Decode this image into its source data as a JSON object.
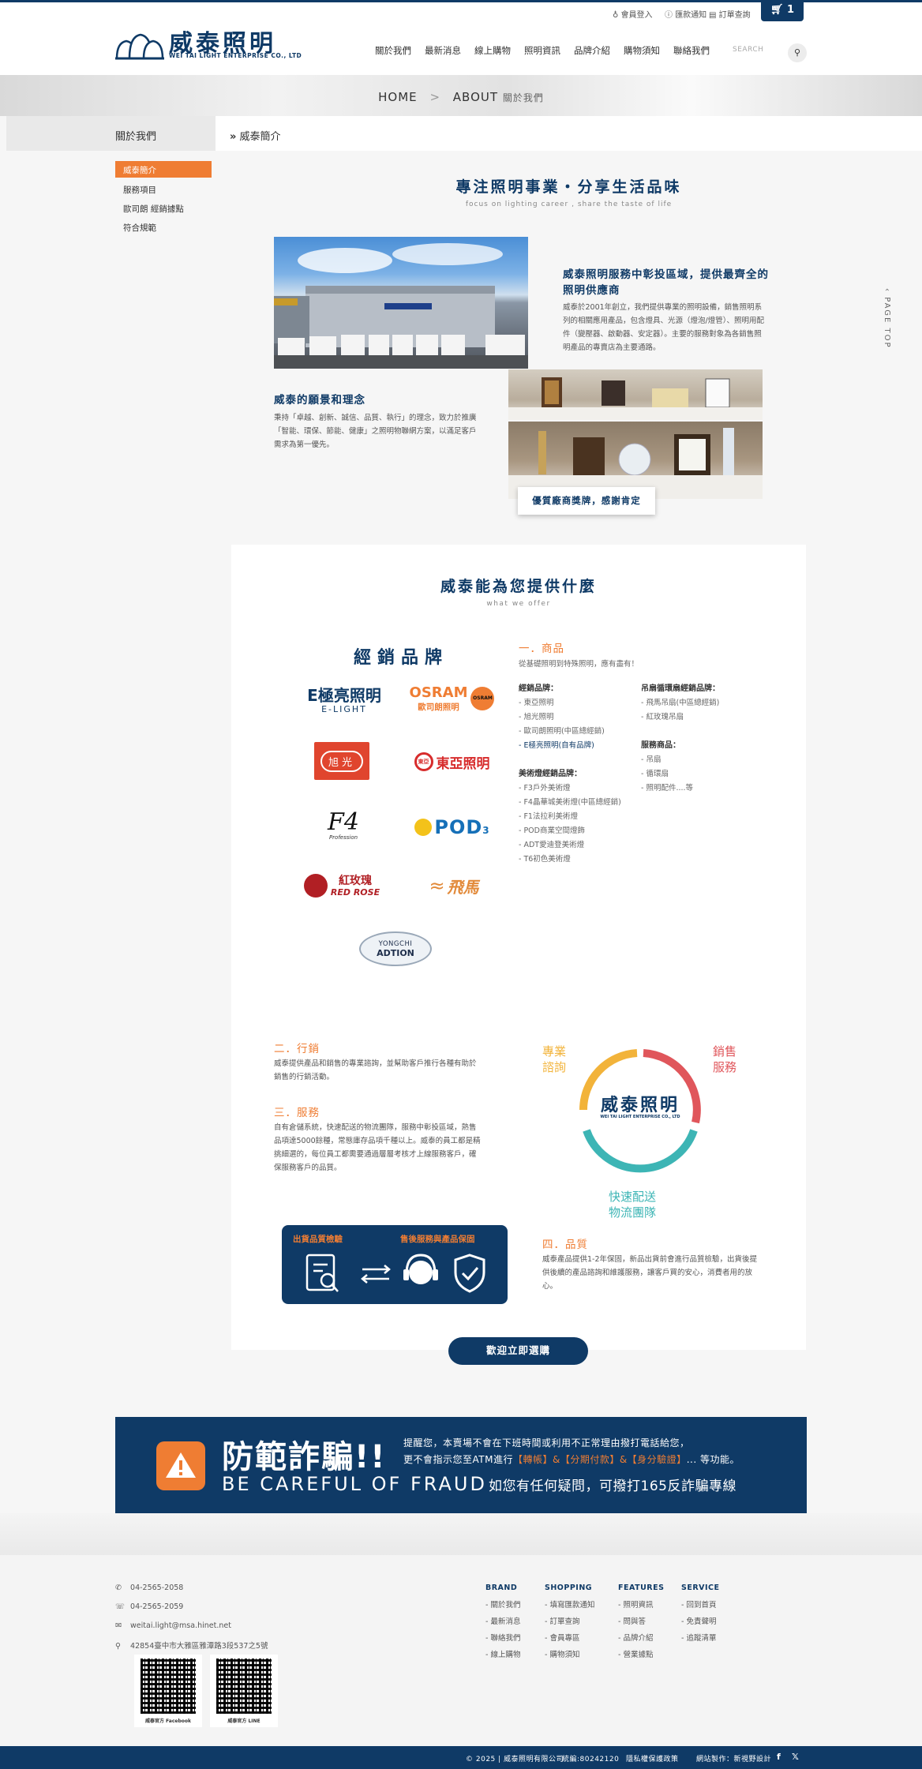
{
  "header": {
    "logo_cn": "威泰照明",
    "logo_en": "WEI TAI LIGHT ENTERPRISE CO., LTD",
    "util_links": [
      "會員登入",
      "匯款通知",
      "訂單查詢"
    ],
    "cart_count": "1",
    "nav": [
      "關於我們",
      "最新消息",
      "線上購物",
      "照明資訊",
      "品牌介紹",
      "購物須知",
      "聯絡我們"
    ],
    "search_placeholder": "SEARCH"
  },
  "breadcrumb": {
    "home": "HOME",
    "sep": ">",
    "about": "ABOUT",
    "sub": "關於我們"
  },
  "sidebar": {
    "title": "關於我們",
    "items": [
      "威泰簡介",
      "服務項目",
      "歐司朗 經銷據點",
      "符合規範"
    ],
    "active_index": 0
  },
  "section_title": "威泰簡介",
  "intro": {
    "title": "專注照明事業・分享生活品味",
    "subtitle": "focus on lighting career , share the taste of life",
    "block1_title": "威泰照明服務中彰投區域，提供最齊全的照明供應商",
    "block1_text": "威泰於2001年創立，我們提供專業的照明設備，銷售照明系列的相關應用產品，包含燈具、光源（燈泡/燈管）、照明用配件（變壓器、啟動器、安定器）。主要的服務對象為各銷售照明產品的專賣店為主要通路。",
    "block2_title": "威泰的願景和理念",
    "block2_text": "秉持「卓越、創新、誠信、品質、執行」的理念，致力於推廣「智能、環保、節能、健康」之照明物聯網方案，以滿足客戶需求為第一優先。",
    "award_label": "優質廠商獎牌，感謝肯定"
  },
  "page_top": "PAGE TOP",
  "offer": {
    "title": "威泰能為您提供什麼",
    "subtitle": "what we offer",
    "brands_title": "經銷品牌",
    "brand_logos": {
      "elight_cn": "E極亮照明",
      "elight_en": "E-LIGHT",
      "osram": "OSRAM",
      "osram_cn": "歐司朗照明",
      "osram_badge": "OSRAM",
      "xuguang": "旭光",
      "dongya": "東亞照明",
      "dongya_badge": "東亞",
      "f4": "F4",
      "f4_sub": "Profession",
      "pod": "POD",
      "pod_sub": "3",
      "redrose_cn": "紅玫瑰",
      "redrose_en": "RED ROSE",
      "feima": "飛馬",
      "yongchi": "YONGCHI",
      "yongchi_sub": "ADTION"
    },
    "products": {
      "heading": "一．商品",
      "desc": "從基礎照明到特殊照明，應有盡有！",
      "col1": [
        {
          "title": "經銷品牌：",
          "items": [
            "- 東亞照明",
            "- 旭光照明",
            "- 歐司朗照明(中區總經銷)",
            "- E極亮照明(自有品牌)"
          ]
        },
        {
          "title": "美術燈經銷品牌：",
          "items": [
            "- F3戶外美術燈",
            "- F4晶華城美術燈(中區總經銷)",
            "- F1法拉利美術燈",
            "- POD商業空間燈飾",
            "- ADT愛迪登美術燈",
            "- T6初色美術燈"
          ]
        }
      ],
      "col2": [
        {
          "title": "吊扇循環扇經銷品牌：",
          "items": [
            "- 飛馬吊扇(中區總經銷)",
            "- 紅玫瑰吊扇"
          ]
        },
        {
          "title": "服務商品：",
          "items": [
            "- 吊扇",
            "- 循環扇",
            "- 照明配件....等"
          ]
        }
      ]
    },
    "marketing_heading": "二．行銷",
    "marketing_text": "威泰提供產品和銷售的專業諮詢，並幫助客戶推行各種有助於銷售的行銷活動。",
    "service_heading": "三．服務",
    "service_text": "自有倉儲系統，快速配送的物流團隊，服務中彰投區域，熱售品項達5000餘種，常態庫存品項千種以上。威泰的員工都是精挑細選的，每位員工都需要通過層層考核才上線服務客戶，確保服務客戶的品質。",
    "ring": {
      "center_cn": "威泰照明",
      "center_en": "WEI TAI LIGHT ENTERPRISE CO., LTD",
      "label_a": "專業\n諮詢",
      "label_b": "銷售\n服務",
      "label_c": "快速配送\n物流團隊"
    },
    "quality_card": {
      "left": "出貨品質檢驗",
      "right": "售後服務與產品保固"
    },
    "quality_heading": "四．品質",
    "quality_text": "威泰產品提供1-2年保固，新品出貨前會進行品質檢驗，出貨後提供後續的產品諮詢和維護服務，讓客戶買的安心，消費者用的放心。",
    "cta": "歡迎立即選購"
  },
  "fraud": {
    "title": "防範詐騙!!",
    "title_en": "BE CAREFUL OF FRAUD",
    "line1": "提醒您，本賣場不會在下班時間或利用不正常理由撥打電話給您，",
    "line2_pre": "更不會指示您至ATM進行",
    "line2_hl": "【轉帳】&【分期付款】&【身分驗證】",
    "line2_post": "... 等功能。",
    "line3": "如您有任何疑問，可撥打165反詐騙專線"
  },
  "footer": {
    "phone": "04-2565-2058",
    "fax": "04-2565-2059",
    "email": "weitai.light@msa.hinet.net",
    "address": "42854臺中市大雅區雅潭路3段537之5號",
    "qr1_label": "威泰官方 Facebook",
    "qr2_label": "威泰官方 LINE",
    "columns": [
      {
        "title": "BRAND",
        "items": [
          "- 關於我們",
          "- 最新消息",
          "- 聯絡我們",
          "- 線上購物"
        ]
      },
      {
        "title": "SHOPPING",
        "items": [
          "- 填寫匯款通知",
          "- 訂單查詢",
          "- 會員專區",
          "- 購物須知"
        ]
      },
      {
        "title": "FEATURES",
        "items": [
          "- 照明資訊",
          "- 問與答",
          "- 品牌介紹",
          "- 營業據點"
        ]
      },
      {
        "title": "SERVICE",
        "items": [
          "- 回到首頁",
          "- 免責聲明",
          "- 追蹤清單"
        ]
      }
    ]
  },
  "bottombar": {
    "copyright": "© 2025 | 威泰照明有限公司",
    "tax": "統編:80242120",
    "privacy": "隱私權保護政策",
    "design": "網站製作：新視野設計"
  },
  "colors": {
    "navy": "#0f3a66",
    "orange": "#ef7d33",
    "teal": "#3db5b5",
    "red": "#e0565b",
    "yellow": "#f2b33a"
  }
}
